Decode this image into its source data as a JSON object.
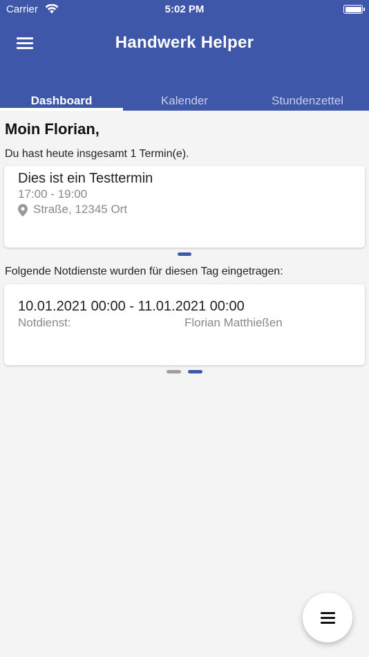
{
  "status_bar": {
    "carrier": "Carrier",
    "time": "5:02 PM"
  },
  "header": {
    "title": "Handwerk Helper"
  },
  "tabs": [
    {
      "label": "Dashboard",
      "active": true
    },
    {
      "label": "Kalender",
      "active": false
    },
    {
      "label": "Stundenzettel",
      "active": false
    }
  ],
  "greeting": "Moin Florian,",
  "summary": "Du hast heute insgesamt 1 Termin(e).",
  "appointment": {
    "title": "Dies ist ein Testtermin",
    "time": "17:00 - 19:00",
    "location": "Straße, 12345 Ort",
    "location_icon": "map-pin-icon"
  },
  "notdienst_heading": "Folgende Notdienste wurden für diesen Tag eingetragen:",
  "notdienst": {
    "range": "10.01.2021 00:00 - 11.01.2021 00:00",
    "label": "Notdienst:",
    "person": "Florian Matthießen"
  },
  "pagers": {
    "appointments": {
      "count": 1,
      "active_index": 0
    },
    "notdienste": {
      "count": 2,
      "active_index": 1
    }
  },
  "colors": {
    "primary": "#3f57a9",
    "background": "#f4f4f4",
    "inactive_dot": "#9e9e9e"
  },
  "icons": {
    "menu": "hamburger-menu-icon",
    "fab": "hamburger-menu-icon"
  }
}
